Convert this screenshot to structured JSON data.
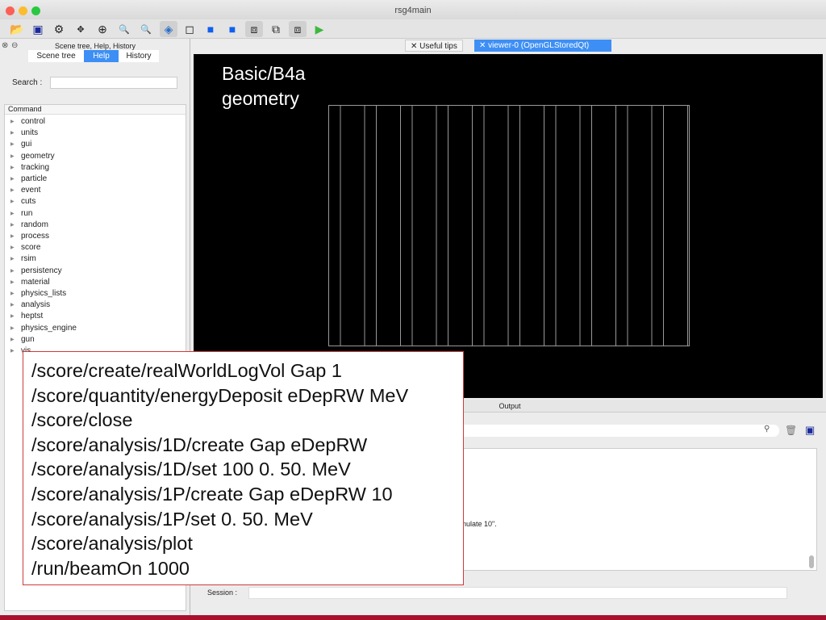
{
  "window": {
    "title": "rsg4main"
  },
  "toolbar": {
    "icons": [
      "open-folder-icon",
      "save-icon",
      "gear-icon",
      "move-icon",
      "target-icon",
      "zoom-out-icon",
      "zoom-in-icon",
      "rotate-icon",
      "wireframe-box-icon",
      "solid-blue-icon",
      "solid-blue-2-icon",
      "perspective-icon",
      "ortho-icon",
      "hidden-line-icon",
      "run-icon"
    ]
  },
  "left_panel": {
    "title": "Scene tree, Help, History",
    "tabs": [
      "Scene tree",
      "Help",
      "History"
    ],
    "active_tab": "Help",
    "search_label": "Search :",
    "search_value": "",
    "tree_header": "Command",
    "commands": [
      "control",
      "units",
      "gui",
      "geometry",
      "tracking",
      "particle",
      "event",
      "cuts",
      "run",
      "random",
      "process",
      "score",
      "rsim",
      "persistency",
      "material",
      "physics_lists",
      "analysis",
      "heptst",
      "physics_engine",
      "gun",
      "vis"
    ]
  },
  "viewer": {
    "tabs": [
      "Useful tips",
      "viewer-0 (OpenGLStoredQt)"
    ],
    "active_tab": "viewer-0 (OpenGLStoredQt)",
    "title_line1": "Basic/B4a",
    "title_line2": "geometry"
  },
  "output": {
    "title": "Output",
    "search_value": "",
    "text_fragment": "nulate 10\".",
    "session_label": "Session :",
    "session_value": ""
  },
  "overlay": {
    "lines": [
      "/score/create/realWorldLogVol Gap 1",
      "/score/quantity/energyDeposit eDepRW MeV",
      "/score/close",
      "/score/analysis/1D/create Gap eDepRW",
      "/score/analysis/1D/set 100 0. 50. MeV",
      "/score/analysis/1P/create Gap eDepRW 10",
      "/score/analysis/1P/set 0. 50. MeV",
      "/score/analysis/plot",
      "/run/beamOn 1000"
    ]
  },
  "colors": {
    "accent": "#3d8ff5",
    "brand_bar": "#a8102e",
    "overlay_border": "#d03a3a"
  }
}
